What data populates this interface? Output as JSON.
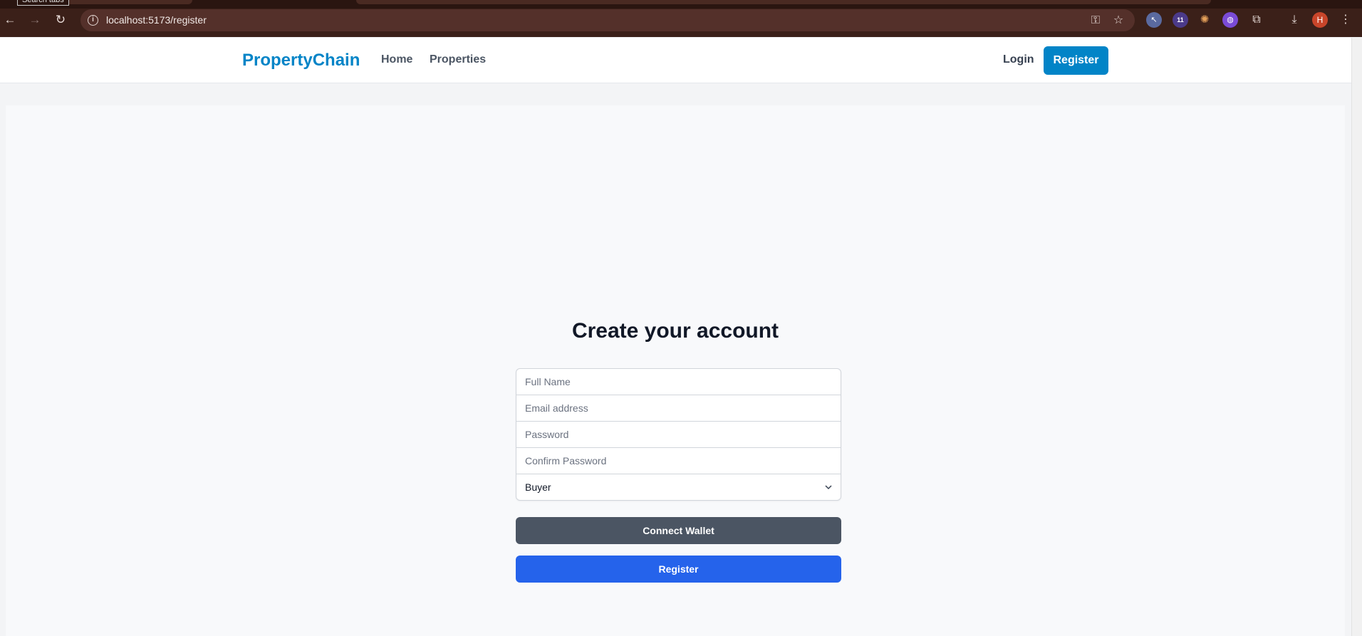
{
  "browser": {
    "tooltip": "Search tabs",
    "url": "localhost:5173/register",
    "profile_initial": "H",
    "extension_badge": "11"
  },
  "navbar": {
    "brand": "PropertyChain",
    "links": [
      "Home",
      "Properties"
    ],
    "login_label": "Login",
    "register_label": "Register"
  },
  "form": {
    "title": "Create your account",
    "full_name_placeholder": "Full Name",
    "email_placeholder": "Email address",
    "password_placeholder": "Password",
    "confirm_password_placeholder": "Confirm Password",
    "role_selected": "Buyer",
    "connect_wallet_label": "Connect Wallet",
    "register_label": "Register"
  }
}
